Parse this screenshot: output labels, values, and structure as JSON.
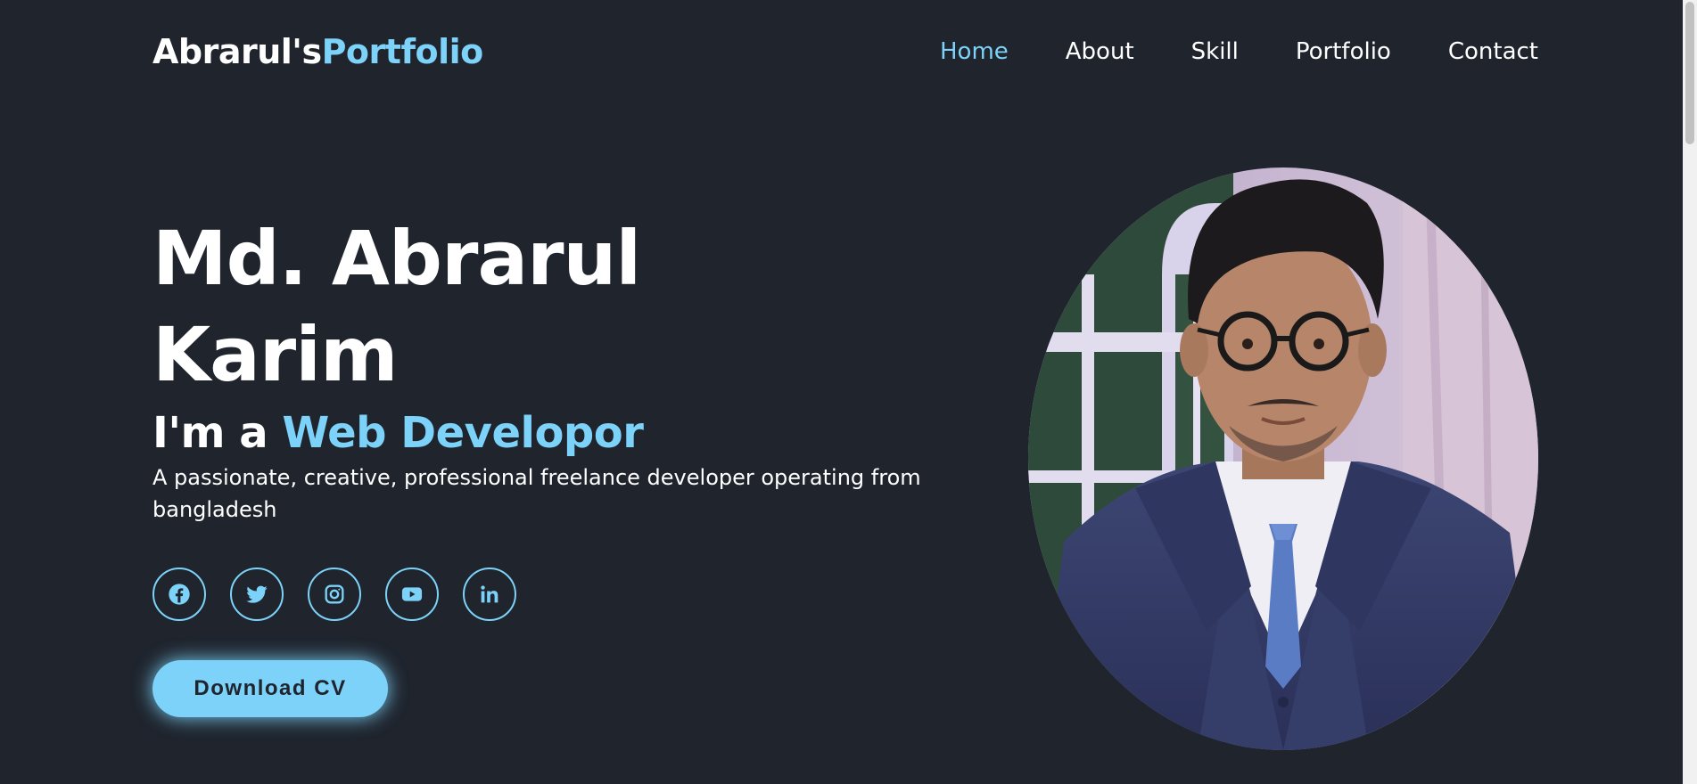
{
  "header": {
    "logo_main": "Abrarul's",
    "logo_accent": "Portfolio",
    "nav": [
      {
        "label": "Home"
      },
      {
        "label": "About"
      },
      {
        "label": "Skill"
      },
      {
        "label": "Portfolio"
      },
      {
        "label": "Contact"
      }
    ]
  },
  "hero": {
    "name_line1": "Md. Abrarul",
    "name_line2": "Karim",
    "role_prefix": "I'm a ",
    "role_accent": "Web Developor",
    "description": "A passionate, creative, professional freelance developer operating from bangladesh",
    "cta_label": "Download CV"
  },
  "socials": [
    {
      "icon": "facebook-icon"
    },
    {
      "icon": "twitter-icon"
    },
    {
      "icon": "instagram-icon"
    },
    {
      "icon": "youtube-icon"
    },
    {
      "icon": "linkedin-icon"
    }
  ],
  "colors": {
    "background": "#1f242d",
    "accent": "#7cd2f8",
    "text": "#ffffff"
  }
}
